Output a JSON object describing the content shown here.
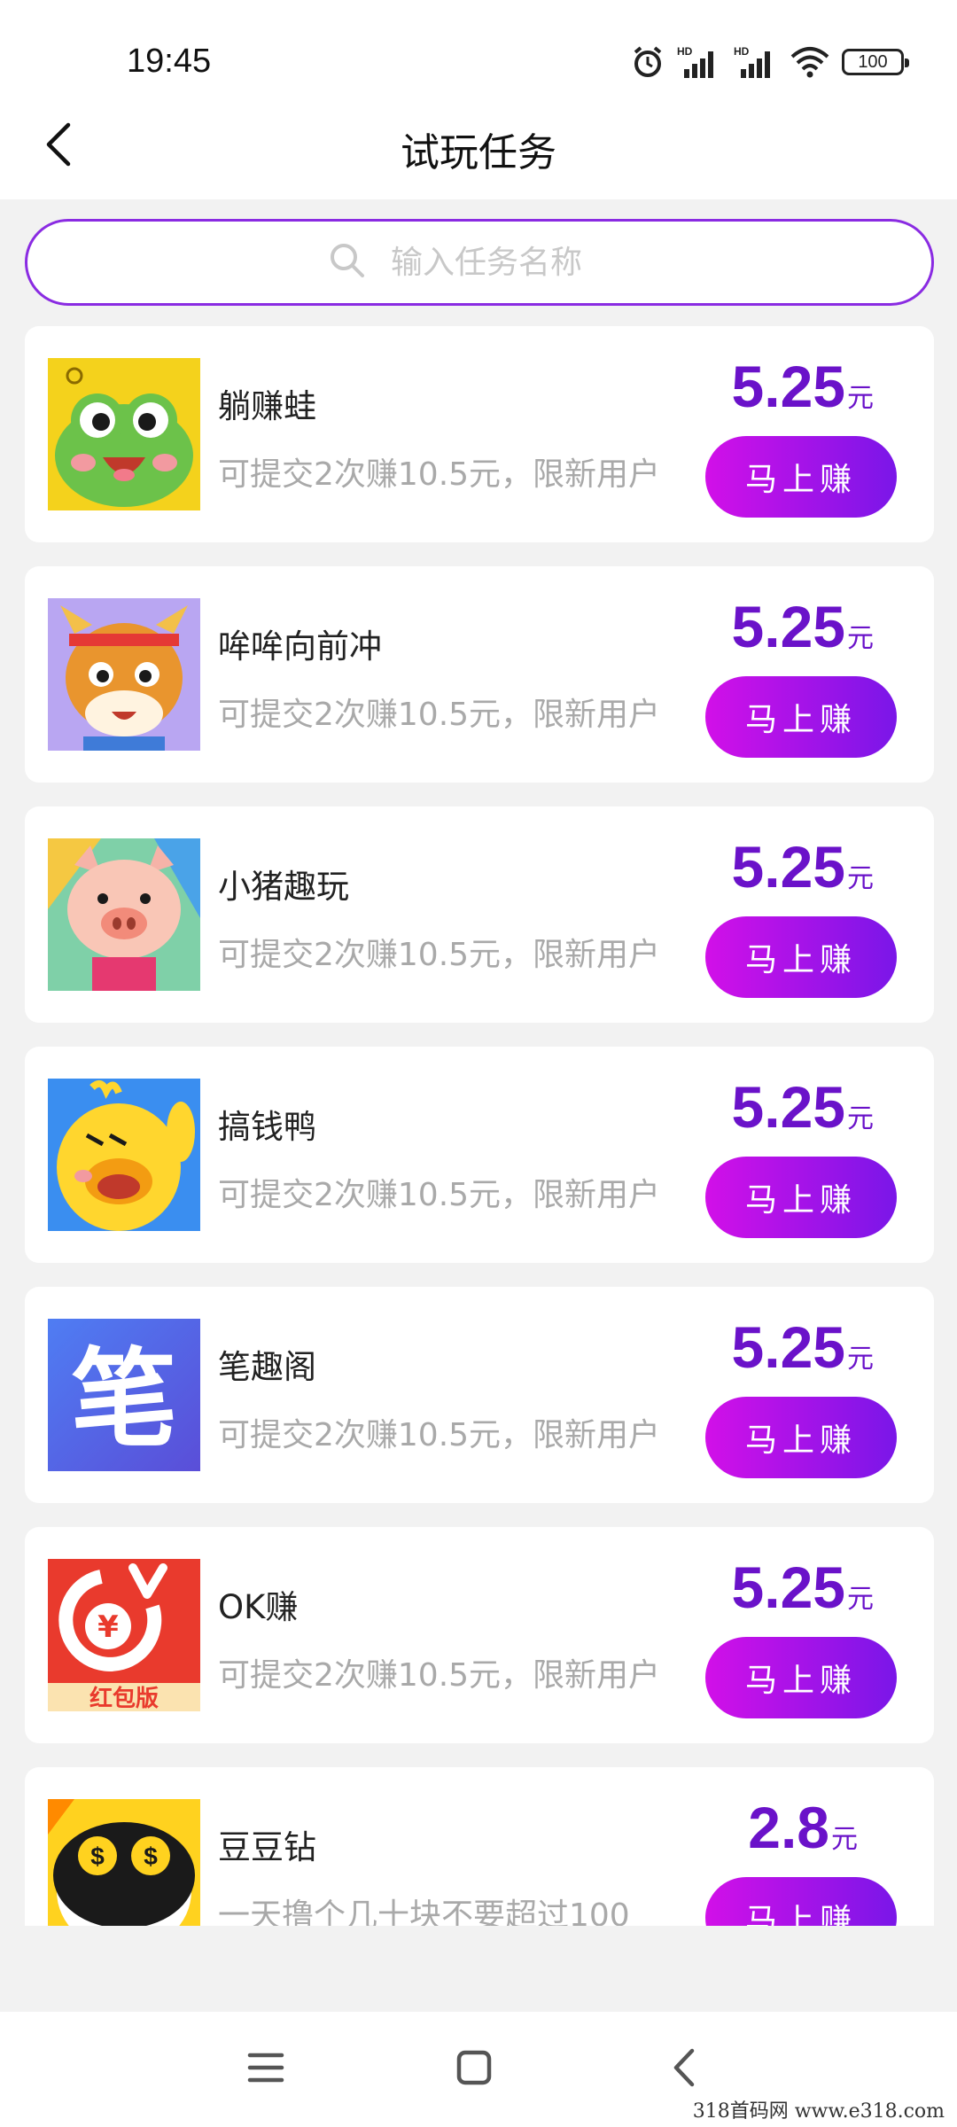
{
  "status_bar": {
    "time": "19:45",
    "battery": "100",
    "icons": [
      "alarm-icon",
      "signal-hd-icon",
      "signal-hd-icon",
      "wifi-icon",
      "battery-icon"
    ]
  },
  "header": {
    "title": "试玩任务",
    "back_icon": "chevron-left-icon"
  },
  "search": {
    "placeholder": "输入任务名称",
    "icon": "search-icon"
  },
  "tasks": [
    {
      "name": "躺赚蛙",
      "desc": "可提交2次赚10.5元，限新用户",
      "reward": "5.25",
      "unit": "元",
      "button": "马上赚",
      "icon": "frog-app-icon"
    },
    {
      "name": "哞哞向前冲",
      "desc": "可提交2次赚10.5元，限新用户",
      "reward": "5.25",
      "unit": "元",
      "button": "马上赚",
      "icon": "cow-app-icon"
    },
    {
      "name": "小猪趣玩",
      "desc": "可提交2次赚10.5元，限新用户",
      "reward": "5.25",
      "unit": "元",
      "button": "马上赚",
      "icon": "pig-app-icon"
    },
    {
      "name": "搞钱鸭",
      "desc": "可提交2次赚10.5元，限新用户",
      "reward": "5.25",
      "unit": "元",
      "button": "马上赚",
      "icon": "duck-app-icon"
    },
    {
      "name": "笔趣阁",
      "desc": "可提交2次赚10.5元，限新用户",
      "reward": "5.25",
      "unit": "元",
      "button": "马上赚",
      "icon": "pen-app-icon",
      "icon_text": "笔"
    },
    {
      "name": "OK赚",
      "desc": "可提交2次赚10.5元，限新用户",
      "reward": "5.25",
      "unit": "元",
      "button": "马上赚",
      "icon": "red-envelope-app-icon",
      "icon_text": "红包版"
    },
    {
      "name": "豆豆钻",
      "desc": "一天撸个几十块不要超过100",
      "reward": "2.8",
      "unit": "元",
      "button": "马上赚",
      "icon": "bean-app-icon"
    }
  ],
  "nav_bar": {
    "icons": [
      "menu-icon",
      "home-icon",
      "back-icon"
    ]
  },
  "watermark": "318首码网  www.e318.com",
  "colors": {
    "accent": "#6a12c9",
    "button_start": "#d210e8",
    "button_end": "#7a16e8",
    "search_border": "#8a2be2"
  }
}
